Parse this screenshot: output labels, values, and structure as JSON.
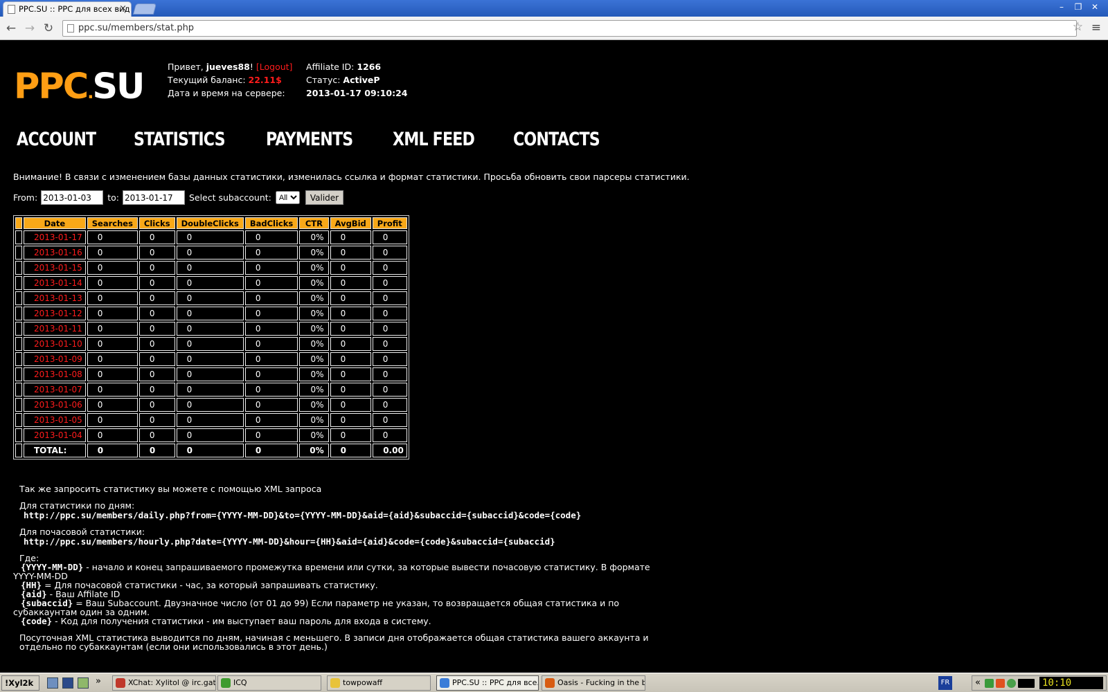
{
  "browser": {
    "tab_title": "PPC.SU :: PPC для всех вид",
    "tab_close": "×",
    "url": "ppc.su/members/stat.php",
    "back_glyph": "←",
    "forward_glyph": "→",
    "reload_glyph": "↻",
    "star_glyph": "☆",
    "menu_glyph": "≡",
    "window_buttons": [
      "–",
      "❐",
      "✕"
    ]
  },
  "header": {
    "logo_ppc": "PPC",
    "logo_dot": ".",
    "logo_su": "SU",
    "greeting_prefix": "Привет, ",
    "username": "jueves88",
    "greeting_suffix": "! ",
    "logout": "[Logout]",
    "balance_label": "Текущий баланс: ",
    "balance_value": "22.11$",
    "server_time_label": "Дата и время на сервере:",
    "affiliate_label": "Affiliate ID: ",
    "affiliate_id": "1266",
    "status_label": "Статус: ",
    "status_value": "ActiveP",
    "server_time_value": "2013-01-17 09:10:24"
  },
  "nav": {
    "items": [
      "ACCOUNT",
      "STATISTICS",
      "PAYMENTS",
      "XML FEED",
      "CONTACTS"
    ]
  },
  "notice": "Внимание! В связи с изменением базы данных статистики, изменилась ссылка и формат статистики. Просьба обновить свои парсеры статистики.",
  "filter": {
    "from_label": "From:",
    "from_value": "2013-01-03",
    "to_label": "to:",
    "to_value": "2013-01-17",
    "subaccount_label": "Select subaccount:",
    "subaccount_value": "All",
    "submit_label": "Valider"
  },
  "table": {
    "columns": [
      "Date",
      "Searches",
      "Clicks",
      "DoubleClicks",
      "BadClicks",
      "CTR",
      "AvgBid",
      "Profit"
    ],
    "rows": [
      [
        "2013-01-17",
        "0",
        "0",
        "0",
        "0",
        "0%",
        "0",
        "0"
      ],
      [
        "2013-01-16",
        "0",
        "0",
        "0",
        "0",
        "0%",
        "0",
        "0"
      ],
      [
        "2013-01-15",
        "0",
        "0",
        "0",
        "0",
        "0%",
        "0",
        "0"
      ],
      [
        "2013-01-14",
        "0",
        "0",
        "0",
        "0",
        "0%",
        "0",
        "0"
      ],
      [
        "2013-01-13",
        "0",
        "0",
        "0",
        "0",
        "0%",
        "0",
        "0"
      ],
      [
        "2013-01-12",
        "0",
        "0",
        "0",
        "0",
        "0%",
        "0",
        "0"
      ],
      [
        "2013-01-11",
        "0",
        "0",
        "0",
        "0",
        "0%",
        "0",
        "0"
      ],
      [
        "2013-01-10",
        "0",
        "0",
        "0",
        "0",
        "0%",
        "0",
        "0"
      ],
      [
        "2013-01-09",
        "0",
        "0",
        "0",
        "0",
        "0%",
        "0",
        "0"
      ],
      [
        "2013-01-08",
        "0",
        "0",
        "0",
        "0",
        "0%",
        "0",
        "0"
      ],
      [
        "2013-01-07",
        "0",
        "0",
        "0",
        "0",
        "0%",
        "0",
        "0"
      ],
      [
        "2013-01-06",
        "0",
        "0",
        "0",
        "0",
        "0%",
        "0",
        "0"
      ],
      [
        "2013-01-05",
        "0",
        "0",
        "0",
        "0",
        "0%",
        "0",
        "0"
      ],
      [
        "2013-01-04",
        "0",
        "0",
        "0",
        "0",
        "0%",
        "0",
        "0"
      ]
    ],
    "total": [
      "TOTAL:",
      "0",
      "0",
      "0",
      "0",
      "0%",
      "0",
      "0.00"
    ]
  },
  "info": {
    "intro": "Так же запросить статистику вы можете с помощью XML запроса",
    "daily_label": "Для статистики по дням:",
    "daily_url": "http://ppc.su/members/daily.php?from={YYYY-MM-DD}&to={YYYY-MM-DD}&aid={aid}&subaccid={subaccid}&code={code}",
    "hourly_label": "Для почасовой статистики:",
    "hourly_url": "http://ppc.su/members/hourly.php?date={YYYY-MM-DD}&hour={HH}&aid={aid}&code={code}&subaccid={subaccid}",
    "where_label": "Где:",
    "params": [
      {
        "key": "{YYYY-MM-DD}",
        "text": " - начало и конец запрашиваемого промежутка времени или сутки, за которые вывести почасовую статистику. В формате YYYY-MM-DD"
      },
      {
        "key": "{HH}",
        "text": " = Для почасовой статистики - час, за который запрашивать статистику."
      },
      {
        "key": "{aid}",
        "text": " - Ваш Affilate ID"
      },
      {
        "key": "{subaccid}",
        "text": " = Ваш Subaccount. Двузначное число (от 01 до 99) Если параметр не указан, то возвращается общая статистика и по субаккаунтам один за одним."
      },
      {
        "key": "{code}",
        "text": " - Код для получения статистики - им выступает ваш пароль для входа в систему."
      }
    ],
    "footer": "Посуточная XML статистика выводится по дням, начиная с меньшего. В записи дня отображается общая статистика вашего аккаунта и отдельно по субаккаунтам (если они использовались в этот день.)"
  },
  "taskbar": {
    "start": "!Xyl2k",
    "more": "»",
    "buttons": [
      {
        "label": "XChat: Xylitol @ irc.gate...",
        "color": "#c0392b"
      },
      {
        "label": "ICQ",
        "color": "#3e9b2e"
      },
      {
        "label": "towpowaff",
        "color": "#e8c33a"
      },
      {
        "label": "PPC.SU :: PPC для все...",
        "color": "#3b7dd8"
      },
      {
        "label": "Oasis - Fucking in the bu...",
        "color": "#d85c12"
      }
    ],
    "lang": "FR",
    "tray_more": "«",
    "clock": "10:10"
  },
  "colors": {
    "accent_orange": "#f8a818",
    "link_red": "#ff1c1c"
  }
}
